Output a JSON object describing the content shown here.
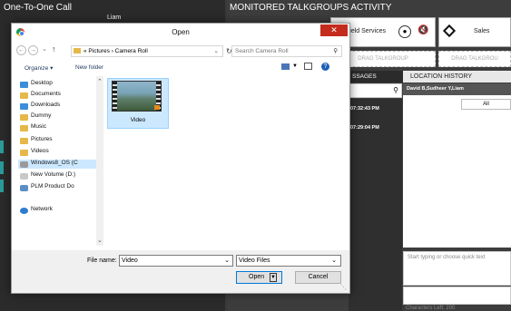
{
  "background": {
    "left_title": "One-To-One Call",
    "left_sub": "Liam",
    "right_title": "MONITORED TALKGROUPS ACTIVITY",
    "talkgroups": [
      "Field Services",
      "Sales"
    ],
    "drag_label_1": "DRAG TALKGROUP",
    "drag_label_2": "DRAG TALKGROU",
    "messages_tab": "SSAGES",
    "location_tab": "LOCATION HISTORY",
    "location_users": "David B,Sudheer Y,Liam",
    "location_filter": "All",
    "message_times": [
      "07:32:43 PM",
      "07:29:04 PM"
    ],
    "quick_text_placeholder": "Start typing or choose quick text",
    "chars_left": "Characters Left: 200"
  },
  "dialog": {
    "title": "Open",
    "breadcrumb": "« Pictures › Camera Roll",
    "search_placeholder": "Search Camera Roll",
    "organize": "Organize ▾",
    "new_folder": "New folder",
    "nav_items": [
      "Desktop",
      "Documents",
      "Downloads",
      "Dummy",
      "Music",
      "Pictures",
      "Videos",
      "Windows8_OS (C",
      "New Volume (D:)",
      "PLM Product Do",
      "Network"
    ],
    "file_label": "Video",
    "file_name_label": "File name:",
    "file_name_value": "Video",
    "file_type": "Video Files",
    "open_label": "Open",
    "cancel_label": "Cancel"
  }
}
